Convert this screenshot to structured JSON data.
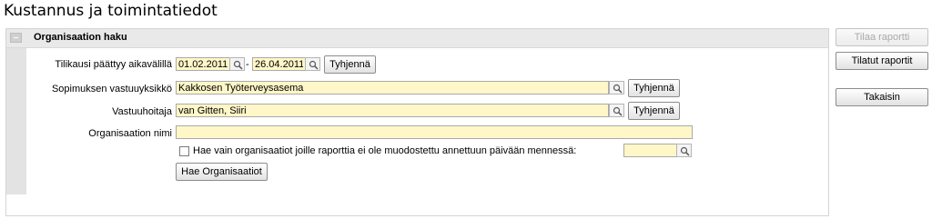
{
  "page": {
    "title": "Kustannus ja toimintatiedot"
  },
  "panel": {
    "heading": "Organisaation haku",
    "collapse_icon": "minus-icon"
  },
  "form": {
    "period_label": "Tilikausi päättyy aikavälillä",
    "period_start": "01.02.2011",
    "period_separator": "-",
    "period_end": "26.04.2011",
    "clear_label": "Tyhjennä",
    "contract_unit_label": "Sopimuksen vastuuyksikkö",
    "contract_unit_value": "Kakkosen Työterveysasema",
    "responsible_label": "Vastuuhoitaja",
    "responsible_value": "van Gitten, Siiri",
    "org_name_label": "Organisaation nimi",
    "org_name_value": "",
    "only_orgs_label": "Hae vain organisaatiot joille raporttia ei ole muodostettu annettuun päivään mennessä:",
    "only_orgs_checked": false,
    "only_orgs_date": "",
    "search_button": "Hae Organisaatiot",
    "lookup_icon": "magnifier-icon"
  },
  "side_buttons": {
    "order_report": "Tilaa raportti",
    "ordered_reports": "Tilatut raportit",
    "back": "Takaisin"
  },
  "colors": {
    "field_bg": "#fff7c8",
    "panel_header_bg": "#e9e9e9",
    "disabled_text": "#a9a9a9"
  }
}
